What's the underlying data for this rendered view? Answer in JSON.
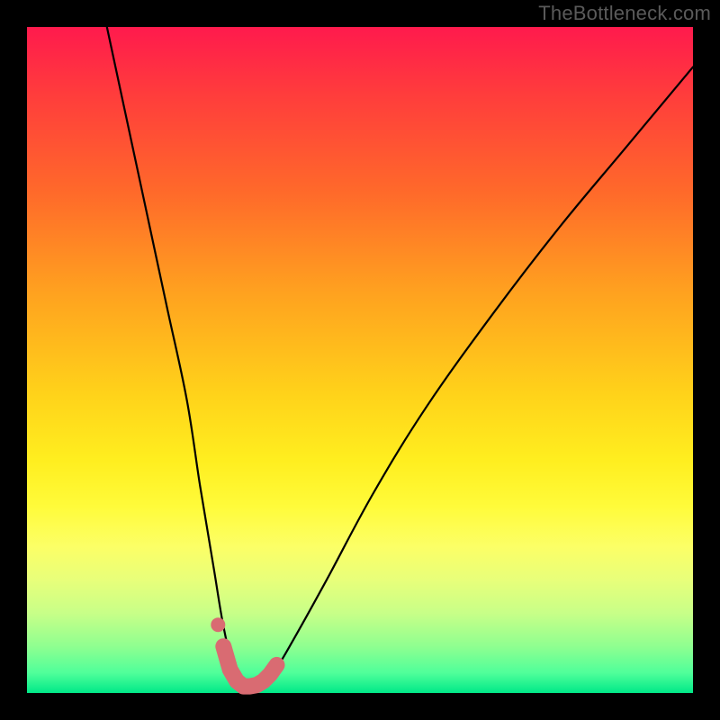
{
  "watermark": "TheBottleneck.com",
  "chart_data": {
    "type": "line",
    "title": "",
    "xlabel": "",
    "ylabel": "",
    "xlim": [
      0,
      100
    ],
    "ylim": [
      0,
      100
    ],
    "background_gradient": {
      "top": "#ff1a4d",
      "mid": "#ffee1f",
      "bottom": "#00e888"
    },
    "series": [
      {
        "name": "bottleneck-curve",
        "color": "#000000",
        "x": [
          12,
          15,
          18,
          21,
          24,
          26,
          28,
          29.5,
          31,
          33,
          35,
          37,
          40,
          45,
          52,
          60,
          70,
          80,
          90,
          100
        ],
        "values": [
          100,
          86,
          72,
          58,
          44,
          31,
          19,
          10,
          4,
          1,
          1,
          3,
          8,
          17,
          30,
          43,
          57,
          70,
          82,
          94
        ]
      }
    ],
    "markers": {
      "name": "highlight-band",
      "color": "#d96b72",
      "x": [
        29.5,
        30.5,
        31.5,
        32.5,
        33.5,
        34.5,
        35.5,
        36.5,
        37.5
      ],
      "values": [
        7.0,
        3.5,
        1.8,
        1.0,
        1.0,
        1.2,
        1.8,
        2.8,
        4.2
      ]
    }
  }
}
